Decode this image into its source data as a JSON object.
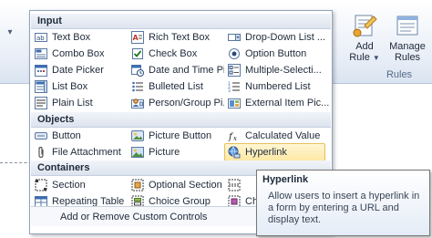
{
  "ribbon": {
    "add_rule": {
      "label": "Add",
      "label2": "Rule"
    },
    "manage_rules": {
      "label": "Manage",
      "label2": "Rules"
    },
    "group_label": "Rules"
  },
  "gallery": {
    "sections": [
      {
        "title": "Input",
        "items": [
          {
            "label": "Text Box",
            "icon": "text-box-icon"
          },
          {
            "label": "Rich Text Box",
            "icon": "rich-text-box-icon"
          },
          {
            "label": "Drop-Down List ...",
            "icon": "drop-down-list-icon"
          },
          {
            "label": "Combo Box",
            "icon": "combo-box-icon"
          },
          {
            "label": "Check Box",
            "icon": "check-box-icon"
          },
          {
            "label": "Option Button",
            "icon": "option-button-icon"
          },
          {
            "label": "Date Picker",
            "icon": "date-picker-icon"
          },
          {
            "label": "Date and Time Pi...",
            "icon": "date-time-picker-icon"
          },
          {
            "label": "Multiple-Selecti...",
            "icon": "multiple-selection-list-icon"
          },
          {
            "label": "List Box",
            "icon": "list-box-icon"
          },
          {
            "label": "Bulleted List",
            "icon": "bulleted-list-icon"
          },
          {
            "label": "Numbered List",
            "icon": "numbered-list-icon"
          },
          {
            "label": "Plain List",
            "icon": "plain-list-icon"
          },
          {
            "label": "Person/Group Pi...",
            "icon": "person-group-picker-icon"
          },
          {
            "label": "External Item Pic...",
            "icon": "external-item-picker-icon"
          }
        ]
      },
      {
        "title": "Objects",
        "items": [
          {
            "label": "Button",
            "icon": "button-icon"
          },
          {
            "label": "Picture Button",
            "icon": "picture-button-icon"
          },
          {
            "label": "Calculated Value",
            "icon": "calculated-value-icon"
          },
          {
            "label": "File Attachment",
            "icon": "file-attachment-icon"
          },
          {
            "label": "Picture",
            "icon": "picture-icon"
          },
          {
            "label": "Hyperlink",
            "icon": "hyperlink-icon"
          }
        ]
      },
      {
        "title": "Containers",
        "items": [
          {
            "label": "Section",
            "icon": "section-icon"
          },
          {
            "label": "Optional Section",
            "icon": "optional-section-icon"
          },
          {
            "label": "",
            "icon": "repeating-section-icon"
          },
          {
            "label": "Repeating Table",
            "icon": "repeating-table-icon"
          },
          {
            "label": "Choice Group",
            "icon": "choice-group-icon"
          },
          {
            "label": "Ch",
            "icon": "choice-section-icon"
          }
        ]
      }
    ],
    "hovered_item": "Hyperlink",
    "footer_label": "Add or Remove Custom Controls"
  },
  "tooltip": {
    "title": "Hyperlink",
    "body": "Allow users to insert a hyperlink in a form by entering a URL and display text."
  }
}
